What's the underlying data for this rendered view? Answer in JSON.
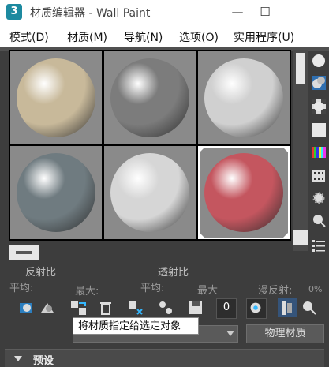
{
  "window": {
    "app_icon_glyph": "3",
    "title": "材质编辑器 - Wall Paint",
    "min_glyph": "—",
    "max_glyph": "☐"
  },
  "menu": {
    "items": [
      "模式(D)",
      "材质(M)",
      "导航(N)",
      "选项(O)",
      "实用程序(U)"
    ]
  },
  "slots": [
    {
      "name": "slot-1",
      "color": "#c8b99a",
      "active": false
    },
    {
      "name": "slot-2",
      "color": "#7c7c7c",
      "active": false
    },
    {
      "name": "slot-3",
      "color": "#d0d0d0",
      "active": false
    },
    {
      "name": "slot-4",
      "color": "#6f7b80",
      "active": false
    },
    {
      "name": "slot-5",
      "color": "#d6d6d6",
      "active": false
    },
    {
      "name": "slot-6",
      "color": "#c4565f",
      "active": true
    }
  ],
  "labels": {
    "reflectance": "反射比",
    "transmittance": "透射比",
    "avg1": "平均:",
    "max1": "最大:",
    "avg2": "平均:",
    "max2": "最大",
    "diffuse": "漫反射:",
    "diffuse_val": "0%"
  },
  "tooltip": "将材质指定给选定对象",
  "physical_material_button": "物理材质",
  "rollout": {
    "title": "预设"
  },
  "bottom_toolbar_number": "0"
}
